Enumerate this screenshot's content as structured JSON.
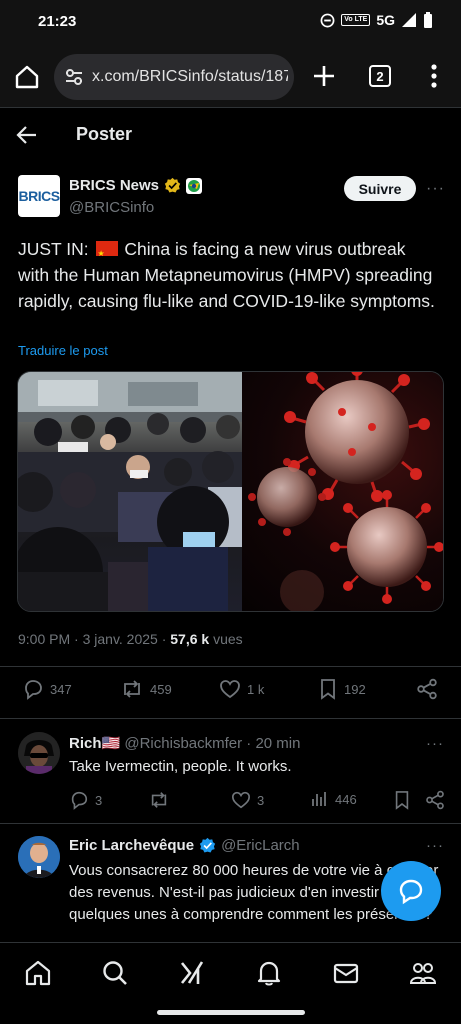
{
  "status_bar": {
    "time": "21:23",
    "volte": "Vo LTE",
    "network": "5G"
  },
  "browser": {
    "url": "x.com/BRICSinfo/status/1875",
    "tab_count": "2"
  },
  "header": {
    "title": "Poster"
  },
  "post": {
    "author_name": "BRICS News",
    "handle": "@BRICSinfo",
    "avatar_text": "BRICS",
    "follow_label": "Suivre",
    "more": "···",
    "text_before_flag": "JUST IN: ",
    "text_after_flag": " China is facing a new virus outbreak with the Human Metapneumovirus (HMPV) spreading rapidly, causing flu-like and COVID-19-like symptoms.",
    "translate_label": "Traduire le post",
    "timestamp": "9:00 PM · 3 janv. 2025 · ",
    "views_count": "57,6 k",
    "views_label": " vues",
    "stats": {
      "replies": "347",
      "reposts": "459",
      "likes": "1 k",
      "bookmarks": "192"
    }
  },
  "replies": [
    {
      "name": "Rich",
      "flag": "🇺🇸",
      "handle": "@Richisbackmfer · 20 min",
      "text": "Take Ivermectin, people. It works.",
      "stats": {
        "replies": "3",
        "reposts": "",
        "likes": "3",
        "views": "446"
      },
      "more": "···"
    },
    {
      "name": "Eric Larchevêque",
      "handle": "@EricLarch",
      "text": "Vous consacrerez 80 000 heures de votre vie à générer des revenus. N'est-il pas judicieux d'en investir quelques unes à comprendre comment les préserver ?",
      "more": "···"
    }
  ],
  "colors": {
    "accent": "#1d9bf0",
    "background": "#000000",
    "text": "#e7e9ea",
    "muted": "#71767b",
    "verified_gold": "#e2b719"
  },
  "icons": [
    "home-icon",
    "site-settings-icon",
    "plus-icon",
    "tabs-icon",
    "overflow-menu-icon",
    "back-arrow-icon",
    "verified-gold-icon",
    "affiliate-badge-icon",
    "reply-icon",
    "repost-icon",
    "like-icon",
    "bookmark-icon",
    "share-icon",
    "views-icon",
    "compose-icon",
    "search-icon",
    "grok-icon",
    "notifications-icon",
    "messages-icon",
    "communities-icon"
  ]
}
